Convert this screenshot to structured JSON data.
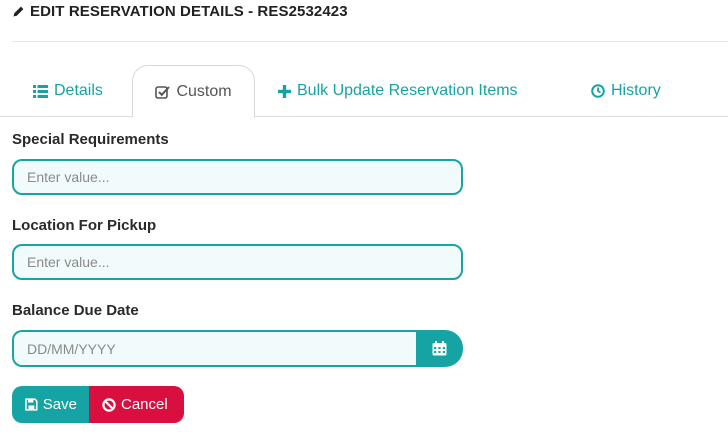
{
  "header": {
    "icon": "pencil-icon",
    "title": "EDIT RESERVATION DETAILS - RES2532423"
  },
  "tabs": [
    {
      "label": "Details",
      "icon": "list-icon",
      "active": false
    },
    {
      "label": "Custom",
      "icon": "checkbox-icon",
      "active": true
    },
    {
      "label": "Bulk Update Reservation Items",
      "icon": "plus-icon",
      "active": false
    },
    {
      "label": "History",
      "icon": "clock-icon",
      "active": false
    }
  ],
  "form": {
    "special_requirements": {
      "label": "Special Requirements",
      "placeholder": "Enter value...",
      "value": ""
    },
    "location_for_pickup": {
      "label": "Location For Pickup",
      "placeholder": "Enter value...",
      "value": ""
    },
    "balance_due_date": {
      "label": "Balance Due Date",
      "placeholder": "DD/MM/YYYY",
      "value": "",
      "icon": "calendar-icon"
    }
  },
  "actions": {
    "save_label": "Save",
    "save_icon": "floppy-disk-icon",
    "cancel_label": "Cancel",
    "cancel_icon": "ban-icon"
  },
  "colors": {
    "accent": "#16a3a3",
    "danger": "#d80f3f",
    "input_bg": "#f1fbfb"
  }
}
